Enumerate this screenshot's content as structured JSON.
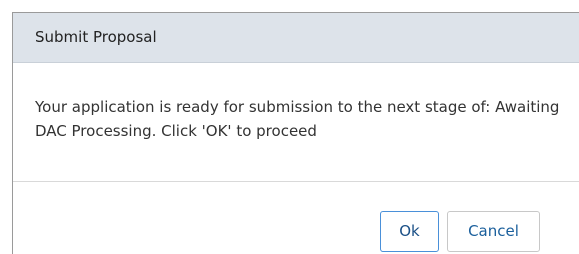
{
  "dialog": {
    "title": "Submit Proposal",
    "message": "Your application is ready for submission to the next stage of: Awaiting DAC Processing. Click 'OK' to proceed",
    "ok_label": "Ok",
    "cancel_label": "Cancel"
  },
  "colors": {
    "header_bg": "#dde3ea",
    "ok_border": "#4a90d9",
    "button_text": "#1a5f9c"
  }
}
